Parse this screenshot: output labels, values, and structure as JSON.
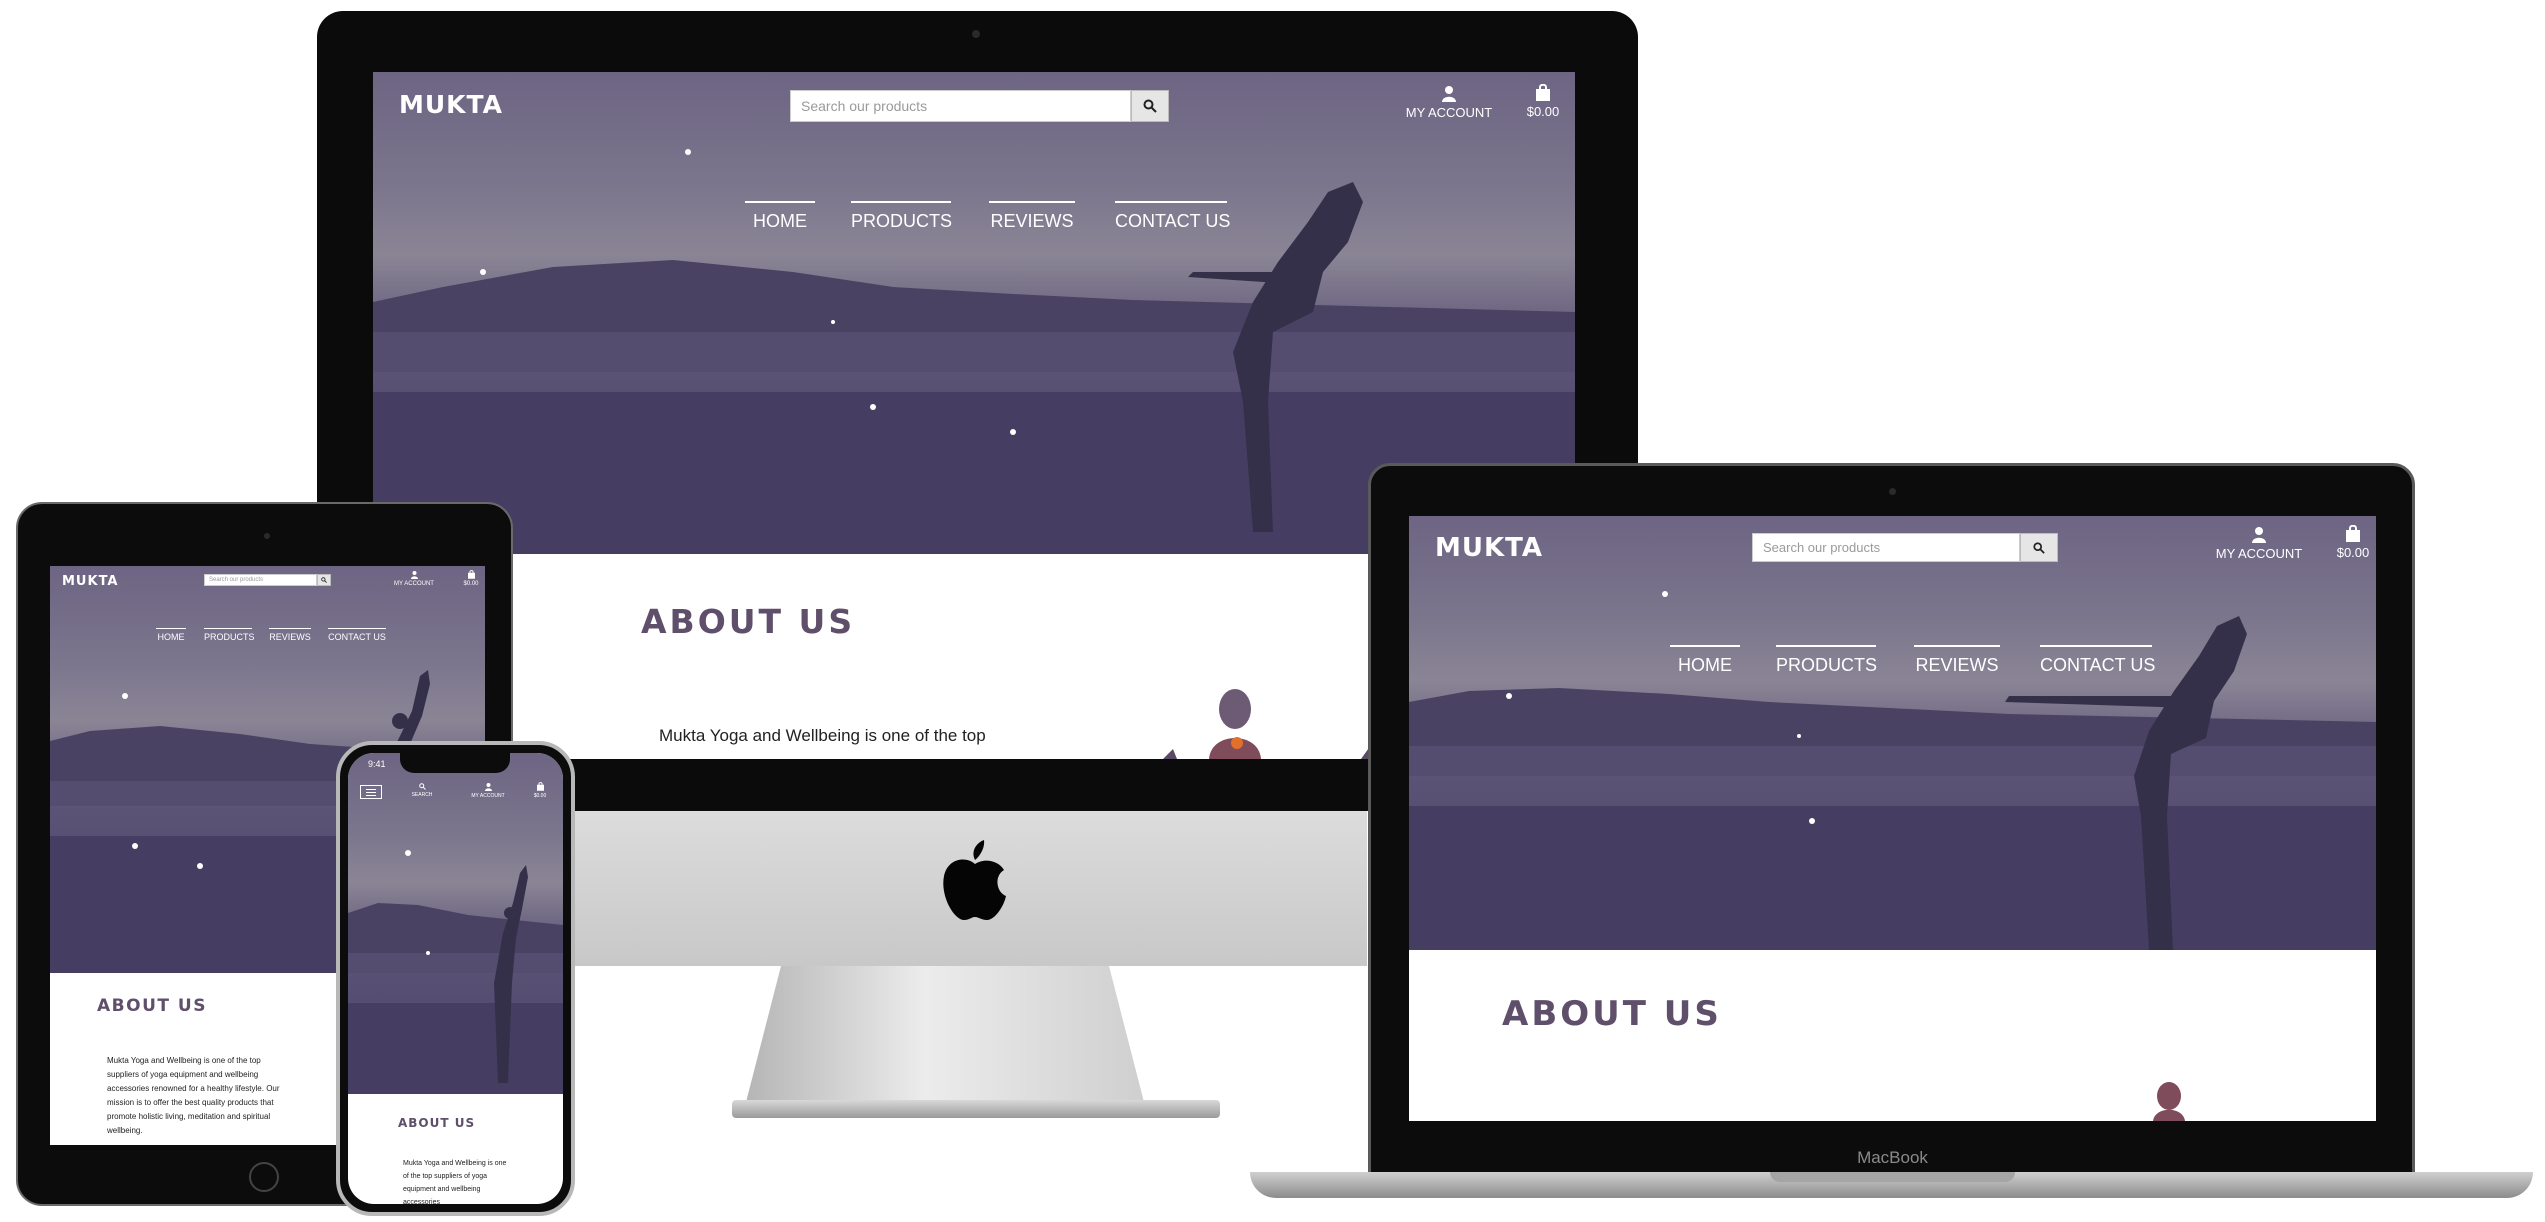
{
  "site": {
    "logo": "MUKTA",
    "search_placeholder": "Search our products",
    "account_label": "MY ACCOUNT",
    "cart_total": "$0.00",
    "search_label": "SEARCH",
    "nav": [
      "HOME",
      "PRODUCTS",
      "REVIEWS",
      "CONTACT US"
    ],
    "about_heading": "ABOUT US",
    "about_intro_line": "Mukta Yoga and Wellbeing is one of the top",
    "tablet_about_text": "Mukta Yoga and Wellbeing is one of the top suppliers of yoga equipment and wellbeing accessories renowned for a healthy lifestyle. Our mission is to offer the best quality products that promote holistic living, meditation and spiritual wellbeing.",
    "phone_about_text": "Mukta Yoga and Wellbeing is one of the top suppliers of yoga equipment and wellbeing accessories"
  },
  "devices": {
    "laptop_brand": "MacBook",
    "phone_time": "9:41"
  },
  "colors": {
    "hero_purple": "#5a5074",
    "heading_purple": "#5f4f6b",
    "bezel": "#0d0d0d"
  }
}
